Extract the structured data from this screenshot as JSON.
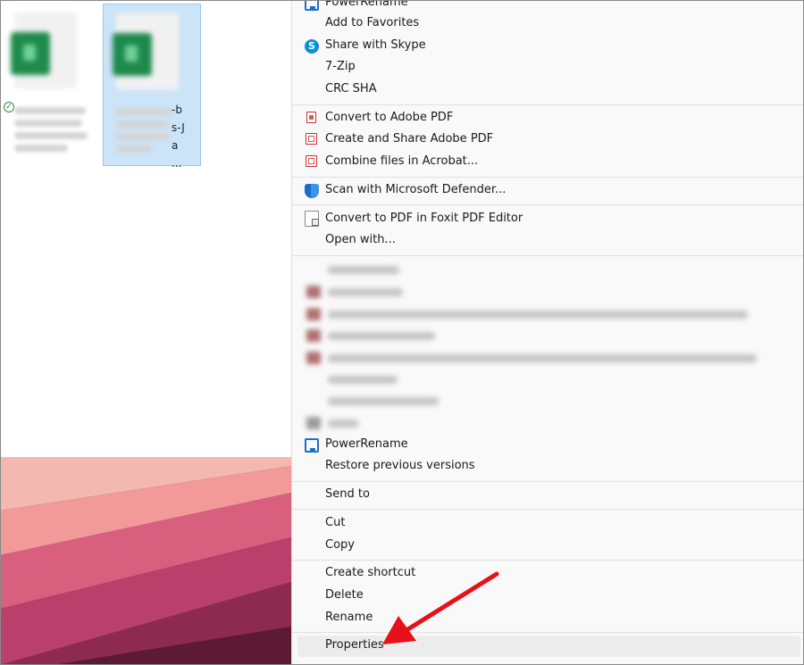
{
  "explorer": {
    "files": [
      {
        "caption_tail": "",
        "selected": false
      },
      {
        "caption_tail": "-b s-J a ...",
        "selected": true
      }
    ]
  },
  "menu": {
    "items": [
      {
        "label": "PowerRename",
        "icon": "powerrename-icon"
      },
      {
        "label": "Add to Favorites",
        "icon": ""
      },
      {
        "label": "Share with Skype",
        "icon": "skype-icon"
      },
      {
        "label": "7-Zip",
        "icon": ""
      },
      {
        "label": "CRC SHA",
        "icon": ""
      },
      {
        "label": "Convert to Adobe PDF",
        "icon": "adobe-pdf-icon"
      },
      {
        "label": "Create and Share Adobe PDF",
        "icon": "adobe-share-pdf-icon"
      },
      {
        "label": "Combine files in Acrobat...",
        "icon": "acrobat-combine-icon"
      },
      {
        "label": "Scan with Microsoft Defender...",
        "icon": "defender-shield-icon"
      },
      {
        "label": "Convert to PDF in Foxit PDF Editor",
        "icon": "foxit-icon"
      },
      {
        "label": "Open with...",
        "icon": ""
      },
      {
        "label": "PowerRename",
        "icon": "powerrename-icon"
      },
      {
        "label": "Restore previous versions",
        "icon": ""
      },
      {
        "label": "Send to",
        "icon": ""
      },
      {
        "label": "Cut",
        "icon": ""
      },
      {
        "label": "Copy",
        "icon": ""
      },
      {
        "label": "Create shortcut",
        "icon": ""
      },
      {
        "label": "Delete",
        "icon": ""
      },
      {
        "label": "Rename",
        "icon": ""
      },
      {
        "label": "Properties",
        "icon": ""
      }
    ]
  },
  "colors": {
    "annotation_arrow": "#e8101a",
    "selection": "#cce4f7",
    "menu_background": "#f9f9f9"
  }
}
